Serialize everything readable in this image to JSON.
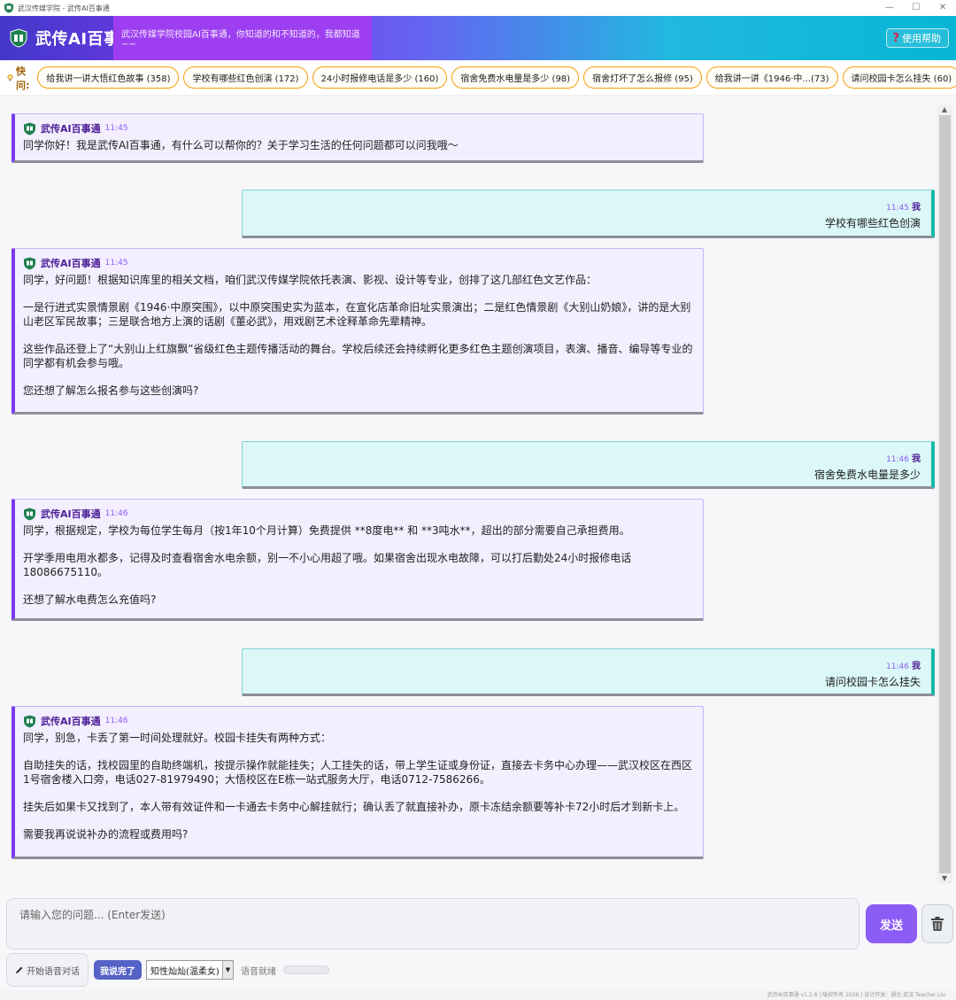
{
  "window": {
    "title": "武汉传媒学院 - 武传AI百事通",
    "controls": {
      "minimize": "—",
      "maximize": "☐",
      "close": "✕"
    }
  },
  "header": {
    "brand": "武传AI百事通",
    "slogan": "武汉传媒学院校园AI百事通，你知道的和不知道的，我都知道~~",
    "help_icon": "?",
    "help_label": "使用帮助"
  },
  "quick": {
    "label": "快问:",
    "chips": [
      "给我讲一讲大悟红色故事 (358)",
      "学校有哪些红色创演 (172)",
      "24小时报修电话是多少 (160)",
      "宿舍免费水电量是多少 (98)",
      "宿舍灯坏了怎么报修 (95)",
      "给我讲一讲《1946·中...(73)",
      "请问校园卡怎么挂失 (60)"
    ]
  },
  "chat": {
    "bot_name": "武传AI百事通",
    "user_name": "我",
    "messages": [
      {
        "role": "bot",
        "time": "11:45",
        "paragraphs": [
          "同学你好！我是武传AI百事通，有什么可以帮你的？关于学习生活的任何问题都可以问我哦～"
        ]
      },
      {
        "role": "user",
        "time": "11:45",
        "text": "学校有哪些红色创演"
      },
      {
        "role": "bot",
        "time": "11:45",
        "paragraphs": [
          "同学，好问题！根据知识库里的相关文档，咱们武汉传媒学院依托表演、影视、设计等专业，创排了这几部红色文艺作品：",
          "一是行进式实景情景剧《1946·中原突围》，以中原突围史实为蓝本，在宣化店革命旧址实景演出；二是红色情景剧《大别山奶娘》，讲的是大别山老区军民故事；三是联合地方上演的话剧《董必武》，用戏剧艺术诠释革命先辈精神。",
          "这些作品还登上了“大别山上红旗飘”省级红色主题传播活动的舞台。学校后续还会持续孵化更多红色主题创演项目，表演、播音、编导等专业的同学都有机会参与哦。",
          "您还想了解怎么报名参与这些创演吗?"
        ]
      },
      {
        "role": "user",
        "time": "11:46",
        "text": "宿舍免费水电量是多少"
      },
      {
        "role": "bot",
        "time": "11:46",
        "paragraphs": [
          "同学，根据规定，学校为每位学生每月（按1年10个月计算）免费提供 **8度电** 和 **3吨水**，超出的部分需要自己承担费用。",
          "开学季用电用水都多，记得及时查看宿舍水电余额，别一不小心用超了哦。如果宿舍出现水电故障，可以打后勤处24小时报修电话18086675110。",
          "还想了解水电费怎么充值吗?"
        ]
      },
      {
        "role": "user",
        "time": "11:46",
        "text": "请问校园卡怎么挂失"
      },
      {
        "role": "bot",
        "time": "11:46",
        "paragraphs": [
          "同学，别急，卡丢了第一时间处理就好。校园卡挂失有两种方式：",
          "自助挂失的话，找校园里的自助终端机，按提示操作就能挂失；人工挂失的话，带上学生证或身份证，直接去卡务中心办理——武汉校区在西区1号宿舍楼入口旁，电话027-81979490；大悟校区在E栋一站式服务大厅，电话0712-7586266。",
          "挂失后如果卡又找到了，本人带有效证件和一卡通去卡务中心解挂就行；确认丢了就直接补办，原卡冻结余额要等补卡72小时后才到新卡上。",
          "需要我再说说补办的流程或费用吗?"
        ]
      }
    ]
  },
  "input": {
    "placeholder": "请输入您的问题... (Enter发送)",
    "send_label": "发送"
  },
  "voice": {
    "start_label": "开始语音对话",
    "done_label": "我说完了",
    "voice_option": "知性灿灿(温柔女)",
    "status": "语音就绪"
  },
  "footer": {
    "text": "武传AI百事通 v1.2.8 | 版权所有 2026 | 设计开发：湖北·武汉 Teacher Liu"
  }
}
